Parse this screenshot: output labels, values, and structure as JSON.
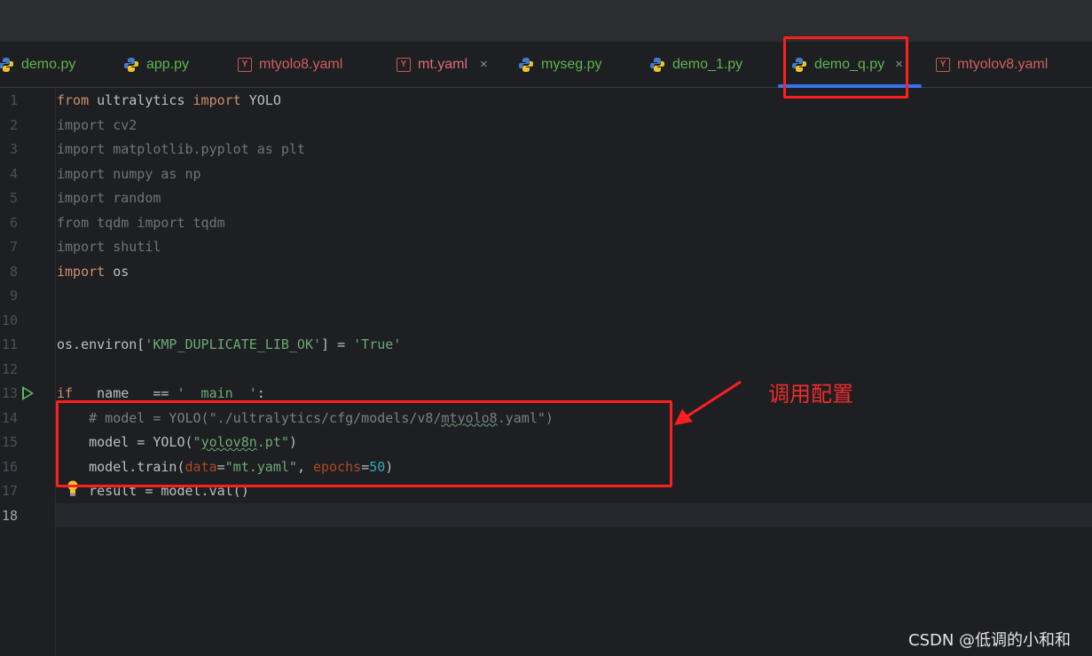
{
  "tabs": [
    {
      "label": "demo.py",
      "type": "python"
    },
    {
      "label": "app.py",
      "type": "python"
    },
    {
      "label": "mtyolo8.yaml",
      "type": "yaml"
    },
    {
      "label": "mt.yaml",
      "type": "yaml",
      "close": "×"
    },
    {
      "label": "myseg.py",
      "type": "python"
    },
    {
      "label": "demo_1.py",
      "type": "python"
    },
    {
      "label": "demo_q.py",
      "type": "python",
      "close": "×"
    },
    {
      "label": "mtyolov8.yaml",
      "type": "yaml"
    }
  ],
  "yaml_icon_letter": "Y",
  "line_numbers": [
    "1",
    "2",
    "3",
    "4",
    "5",
    "6",
    "7",
    "8",
    "9",
    "10",
    "11",
    "12",
    "13",
    "14",
    "15",
    "16",
    "17",
    "18"
  ],
  "code": {
    "l1": {
      "a": "from",
      "b": " ultralytics ",
      "c": "import",
      "d": " YOLO"
    },
    "l2": "import cv2",
    "l3": "import matplotlib.pyplot as plt",
    "l4": "import numpy as np",
    "l5": "import random",
    "l6": "from tqdm import tqdm",
    "l7": "import shutil",
    "l8": {
      "a": "import",
      "b": " os"
    },
    "l11": {
      "a": "os.environ[",
      "b": "'KMP_DUPLICATE_LIB_OK'",
      "c": "] = ",
      "d": "'True'"
    },
    "l13": {
      "a": "if",
      "b": " __name__ == ",
      "c": "'__main__'",
      "d": ":"
    },
    "l14": {
      "a": "    # model = YOLO(\"./ultralytics/cfg/models/v8/",
      "b": "mtyolo8",
      "c": ".yaml\")"
    },
    "l15": {
      "a": "    model = YOLO(",
      "b": "\"",
      "c": "yolov8n",
      "d": ".pt\"",
      "e": ")"
    },
    "l16": {
      "a": "    model.train(",
      "b": "data",
      "c": "=",
      "d": "\"mt.yaml\"",
      "e": ", ",
      "f": "epochs",
      "g": "=",
      "h": "50",
      "i": ")"
    },
    "l17": "    result = model.val()"
  },
  "annotation": "调用配置",
  "watermark": "CSDN @低调的小和和",
  "colors": {
    "accent": "#3574f0",
    "highlight": "#ff1f1f",
    "keyword": "#cf8e6d",
    "string": "#6aab73"
  }
}
